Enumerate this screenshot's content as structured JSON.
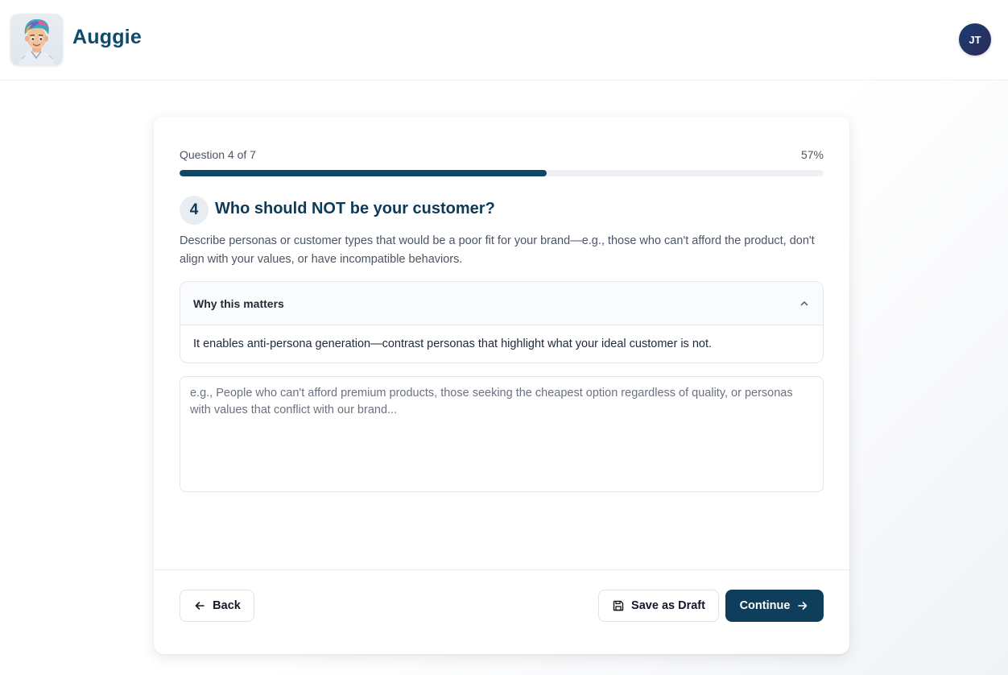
{
  "header": {
    "brand_name": "Auggie",
    "user_initials": "JT",
    "avatar_icon": "cartoon-avatar-icon"
  },
  "progress": {
    "label": "Question 4 of 7",
    "percent_text": "57%",
    "fraction": 0.57
  },
  "question": {
    "number": "4",
    "title": "Who should NOT be your customer?",
    "description": "Describe personas or customer types that would be a poor fit for your brand—e.g., those who can't afford the product, don't align with your values, or have incompatible behaviors."
  },
  "why_matters": {
    "title": "Why this matters",
    "body": "It enables anti-persona generation—contrast personas that highlight what your ideal customer is not.",
    "expanded": true
  },
  "answer": {
    "value": "",
    "placeholder": "e.g., People who can't afford premium products, those seeking the cheapest option regardless of quality, or personas with values that conflict with our brand..."
  },
  "footer": {
    "back_label": "Back",
    "draft_label": "Save as Draft",
    "continue_label": "Continue"
  },
  "colors": {
    "brand": "#0d4a6b",
    "primary_button": "#0f3e5c",
    "progress_fill": "#0f4566"
  }
}
